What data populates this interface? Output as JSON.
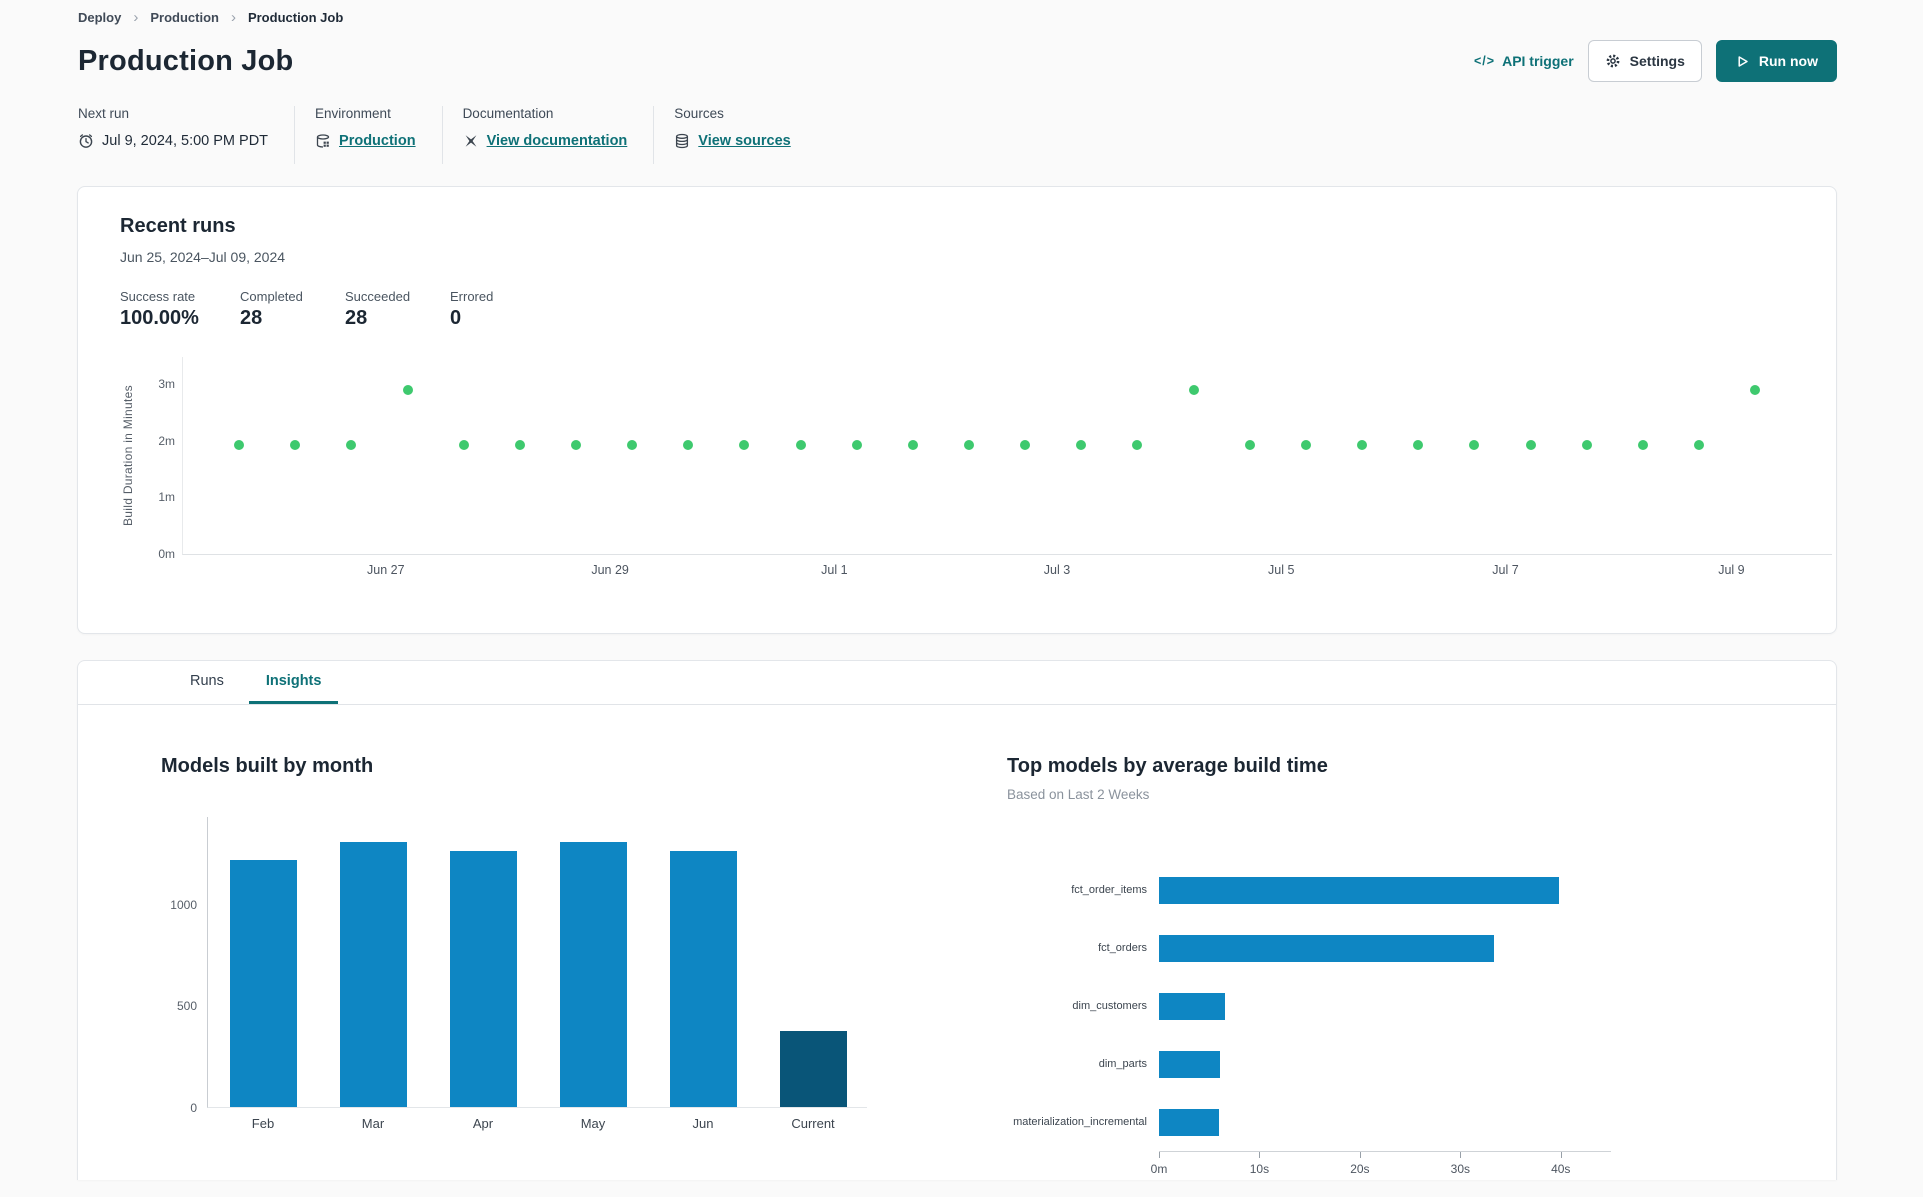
{
  "breadcrumb": {
    "items": [
      "Deploy",
      "Production",
      "Production Job"
    ],
    "chevron_icon": "›"
  },
  "header": {
    "title": "Production Job",
    "api_trigger_label": "API trigger",
    "api_trigger_icon": "</>",
    "settings_label": "Settings",
    "run_now_label": "Run now"
  },
  "info": {
    "columns": [
      {
        "label": "Next run",
        "value": "Jul 9, 2024, 5:00 PM PDT",
        "icon": "clock-icon",
        "link": false
      },
      {
        "label": "Environment",
        "value": "Production",
        "icon": "environment-icon",
        "link": true
      },
      {
        "label": "Documentation",
        "value": "View documentation",
        "icon": "docs-icon",
        "link": true
      },
      {
        "label": "Sources",
        "value": "View sources",
        "icon": "database-icon",
        "link": true
      }
    ]
  },
  "recent_runs": {
    "title": "Recent runs",
    "date_range": "Jun 25, 2024–Jul 09, 2024",
    "stats": [
      {
        "label": "Success rate",
        "value": "100.00%"
      },
      {
        "label": "Completed",
        "value": "28"
      },
      {
        "label": "Succeeded",
        "value": "28"
      },
      {
        "label": "Errored",
        "value": "0"
      }
    ]
  },
  "tabs": [
    {
      "label": "Runs",
      "active": false
    },
    {
      "label": "Insights",
      "active": true
    }
  ],
  "colors": {
    "accent_teal": "#0e7177",
    "dot_green": "#3ec96e",
    "bar_blue": "#0e86c3",
    "bar_dark_blue": "#095578"
  },
  "chart_data": [
    {
      "type": "scatter",
      "title": "Recent runs build durations",
      "ylabel": "Build Duration in Minutes",
      "ylim": [
        0,
        3.5
      ],
      "y_ticks": [
        {
          "value": 0,
          "label": "0m"
        },
        {
          "value": 1,
          "label": "1m"
        },
        {
          "value": 2,
          "label": "2m"
        },
        {
          "value": 3,
          "label": "3m"
        }
      ],
      "x_ticks": [
        {
          "frac": 0.123,
          "label": "Jun 27"
        },
        {
          "frac": 0.259,
          "label": "Jun 29"
        },
        {
          "frac": 0.395,
          "label": "Jul 1"
        },
        {
          "frac": 0.53,
          "label": "Jul 3"
        },
        {
          "frac": 0.666,
          "label": "Jul 5"
        },
        {
          "frac": 0.802,
          "label": "Jul 7"
        },
        {
          "frac": 0.939,
          "label": "Jul 9"
        }
      ],
      "point_color": "#3ec96e",
      "grid": false,
      "points": [
        {
          "frac": 0.034,
          "minutes": 1.93
        },
        {
          "frac": 0.0681,
          "minutes": 1.93
        },
        {
          "frac": 0.1021,
          "minutes": 1.93
        },
        {
          "frac": 0.1362,
          "minutes": 2.9
        },
        {
          "frac": 0.1702,
          "minutes": 1.93
        },
        {
          "frac": 0.2043,
          "minutes": 1.93
        },
        {
          "frac": 0.2383,
          "minutes": 1.93
        },
        {
          "frac": 0.2724,
          "minutes": 1.93
        },
        {
          "frac": 0.3064,
          "minutes": 1.93
        },
        {
          "frac": 0.3405,
          "minutes": 1.93
        },
        {
          "frac": 0.3745,
          "minutes": 1.93
        },
        {
          "frac": 0.4086,
          "minutes": 1.93
        },
        {
          "frac": 0.4426,
          "minutes": 1.93
        },
        {
          "frac": 0.4767,
          "minutes": 1.93
        },
        {
          "frac": 0.5107,
          "minutes": 1.93
        },
        {
          "frac": 0.5448,
          "minutes": 1.93
        },
        {
          "frac": 0.5788,
          "minutes": 1.93
        },
        {
          "frac": 0.6129,
          "minutes": 2.9
        },
        {
          "frac": 0.6469,
          "minutes": 1.93
        },
        {
          "frac": 0.681,
          "minutes": 1.93
        },
        {
          "frac": 0.715,
          "minutes": 1.93
        },
        {
          "frac": 0.7491,
          "minutes": 1.93
        },
        {
          "frac": 0.7831,
          "minutes": 1.93
        },
        {
          "frac": 0.8172,
          "minutes": 1.93
        },
        {
          "frac": 0.8512,
          "minutes": 1.93
        },
        {
          "frac": 0.8853,
          "minutes": 1.93
        },
        {
          "frac": 0.9193,
          "minutes": 1.93
        },
        {
          "frac": 0.9534,
          "minutes": 2.9
        }
      ]
    },
    {
      "type": "bar",
      "title": "Models built by month",
      "categories": [
        "Feb",
        "Mar",
        "Apr",
        "May",
        "Jun",
        "Current"
      ],
      "values": [
        1215,
        1300,
        1260,
        1300,
        1260,
        375
      ],
      "bar_colors": [
        "#0e86c3",
        "#0e86c3",
        "#0e86c3",
        "#0e86c3",
        "#0e86c3",
        "#095578"
      ],
      "y_ticks": [
        0,
        500,
        1000
      ],
      "ylim": [
        0,
        1430
      ],
      "grid": false
    },
    {
      "type": "bar-horizontal",
      "title": "Top models by average build time",
      "subtitle": "Based on Last 2 Weeks",
      "categories": [
        "fct_order_items",
        "fct_orders",
        "dim_customers",
        "dim_parts",
        "materialization_incremental"
      ],
      "values_seconds": [
        39.8,
        33.4,
        6.6,
        6.1,
        6.0
      ],
      "x_ticks": [
        {
          "value": 0,
          "label": "0m"
        },
        {
          "value": 10,
          "label": "10s"
        },
        {
          "value": 20,
          "label": "20s"
        },
        {
          "value": 30,
          "label": "30s"
        },
        {
          "value": 40,
          "label": "40s"
        }
      ],
      "xlim": [
        0,
        45
      ],
      "bar_color": "#0e86c3",
      "grid": false
    }
  ]
}
